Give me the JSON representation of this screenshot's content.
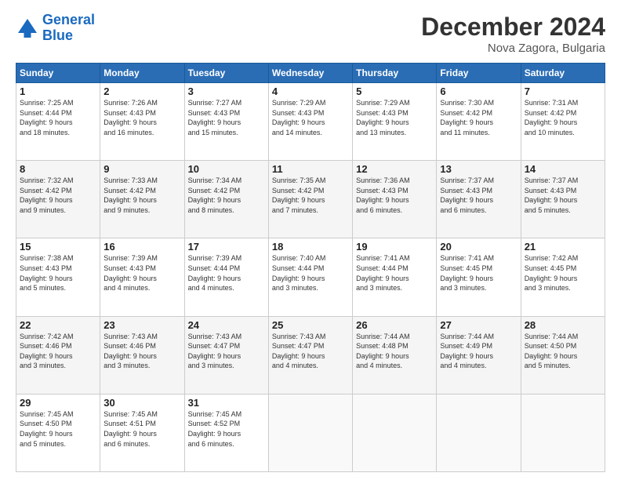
{
  "header": {
    "logo_line1": "General",
    "logo_line2": "Blue",
    "month": "December 2024",
    "location": "Nova Zagora, Bulgaria"
  },
  "weekdays": [
    "Sunday",
    "Monday",
    "Tuesday",
    "Wednesday",
    "Thursday",
    "Friday",
    "Saturday"
  ],
  "weeks": [
    [
      {
        "day": "1",
        "info": "Sunrise: 7:25 AM\nSunset: 4:44 PM\nDaylight: 9 hours\nand 18 minutes."
      },
      {
        "day": "2",
        "info": "Sunrise: 7:26 AM\nSunset: 4:43 PM\nDaylight: 9 hours\nand 16 minutes."
      },
      {
        "day": "3",
        "info": "Sunrise: 7:27 AM\nSunset: 4:43 PM\nDaylight: 9 hours\nand 15 minutes."
      },
      {
        "day": "4",
        "info": "Sunrise: 7:29 AM\nSunset: 4:43 PM\nDaylight: 9 hours\nand 14 minutes."
      },
      {
        "day": "5",
        "info": "Sunrise: 7:29 AM\nSunset: 4:43 PM\nDaylight: 9 hours\nand 13 minutes."
      },
      {
        "day": "6",
        "info": "Sunrise: 7:30 AM\nSunset: 4:42 PM\nDaylight: 9 hours\nand 11 minutes."
      },
      {
        "day": "7",
        "info": "Sunrise: 7:31 AM\nSunset: 4:42 PM\nDaylight: 9 hours\nand 10 minutes."
      }
    ],
    [
      {
        "day": "8",
        "info": "Sunrise: 7:32 AM\nSunset: 4:42 PM\nDaylight: 9 hours\nand 9 minutes."
      },
      {
        "day": "9",
        "info": "Sunrise: 7:33 AM\nSunset: 4:42 PM\nDaylight: 9 hours\nand 9 minutes."
      },
      {
        "day": "10",
        "info": "Sunrise: 7:34 AM\nSunset: 4:42 PM\nDaylight: 9 hours\nand 8 minutes."
      },
      {
        "day": "11",
        "info": "Sunrise: 7:35 AM\nSunset: 4:42 PM\nDaylight: 9 hours\nand 7 minutes."
      },
      {
        "day": "12",
        "info": "Sunrise: 7:36 AM\nSunset: 4:43 PM\nDaylight: 9 hours\nand 6 minutes."
      },
      {
        "day": "13",
        "info": "Sunrise: 7:37 AM\nSunset: 4:43 PM\nDaylight: 9 hours\nand 6 minutes."
      },
      {
        "day": "14",
        "info": "Sunrise: 7:37 AM\nSunset: 4:43 PM\nDaylight: 9 hours\nand 5 minutes."
      }
    ],
    [
      {
        "day": "15",
        "info": "Sunrise: 7:38 AM\nSunset: 4:43 PM\nDaylight: 9 hours\nand 5 minutes."
      },
      {
        "day": "16",
        "info": "Sunrise: 7:39 AM\nSunset: 4:43 PM\nDaylight: 9 hours\nand 4 minutes."
      },
      {
        "day": "17",
        "info": "Sunrise: 7:39 AM\nSunset: 4:44 PM\nDaylight: 9 hours\nand 4 minutes."
      },
      {
        "day": "18",
        "info": "Sunrise: 7:40 AM\nSunset: 4:44 PM\nDaylight: 9 hours\nand 3 minutes."
      },
      {
        "day": "19",
        "info": "Sunrise: 7:41 AM\nSunset: 4:44 PM\nDaylight: 9 hours\nand 3 minutes."
      },
      {
        "day": "20",
        "info": "Sunrise: 7:41 AM\nSunset: 4:45 PM\nDaylight: 9 hours\nand 3 minutes."
      },
      {
        "day": "21",
        "info": "Sunrise: 7:42 AM\nSunset: 4:45 PM\nDaylight: 9 hours\nand 3 minutes."
      }
    ],
    [
      {
        "day": "22",
        "info": "Sunrise: 7:42 AM\nSunset: 4:46 PM\nDaylight: 9 hours\nand 3 minutes."
      },
      {
        "day": "23",
        "info": "Sunrise: 7:43 AM\nSunset: 4:46 PM\nDaylight: 9 hours\nand 3 minutes."
      },
      {
        "day": "24",
        "info": "Sunrise: 7:43 AM\nSunset: 4:47 PM\nDaylight: 9 hours\nand 3 minutes."
      },
      {
        "day": "25",
        "info": "Sunrise: 7:43 AM\nSunset: 4:47 PM\nDaylight: 9 hours\nand 4 minutes."
      },
      {
        "day": "26",
        "info": "Sunrise: 7:44 AM\nSunset: 4:48 PM\nDaylight: 9 hours\nand 4 minutes."
      },
      {
        "day": "27",
        "info": "Sunrise: 7:44 AM\nSunset: 4:49 PM\nDaylight: 9 hours\nand 4 minutes."
      },
      {
        "day": "28",
        "info": "Sunrise: 7:44 AM\nSunset: 4:50 PM\nDaylight: 9 hours\nand 5 minutes."
      }
    ],
    [
      {
        "day": "29",
        "info": "Sunrise: 7:45 AM\nSunset: 4:50 PM\nDaylight: 9 hours\nand 5 minutes."
      },
      {
        "day": "30",
        "info": "Sunrise: 7:45 AM\nSunset: 4:51 PM\nDaylight: 9 hours\nand 6 minutes."
      },
      {
        "day": "31",
        "info": "Sunrise: 7:45 AM\nSunset: 4:52 PM\nDaylight: 9 hours\nand 6 minutes."
      },
      null,
      null,
      null,
      null
    ]
  ]
}
